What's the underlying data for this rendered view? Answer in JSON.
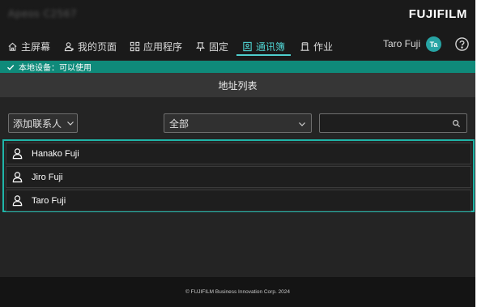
{
  "titlebar": {
    "device_name": "Apeos C2567",
    "brand": "FUJIFILM"
  },
  "nav": {
    "items": [
      {
        "label": "主屏幕",
        "icon": "home-icon"
      },
      {
        "label": "我的页面",
        "icon": "person-icon"
      },
      {
        "label": "应用程序",
        "icon": "apps-grid-icon"
      },
      {
        "label": "固定",
        "icon": "pin-icon"
      },
      {
        "label": "通讯簿",
        "icon": "address-book-icon",
        "active": true
      },
      {
        "label": "作业",
        "icon": "jobs-icon"
      }
    ],
    "user_name": "Taro Fuji",
    "user_initials": "Ta",
    "help_icon": "help-icon"
  },
  "status": {
    "text": "本地设备：可以使用",
    "color": "#0f8a7a"
  },
  "page": {
    "title": "地址列表"
  },
  "toolbar": {
    "add_contact_label": "添加联系人",
    "filter_selected": "全部",
    "search_value": "",
    "search_placeholder": ""
  },
  "contacts": [
    {
      "name": "Hanako Fuji"
    },
    {
      "name": "Jiro Fuji"
    },
    {
      "name": "Taro Fuji"
    }
  ],
  "footer": {
    "copyright": "© FUJIFILM Business Innovation Corp. 2024"
  },
  "colors": {
    "accent": "#4fd0cf",
    "selection_border": "#1fb5a8",
    "avatar_bg": "#27a4a4"
  }
}
